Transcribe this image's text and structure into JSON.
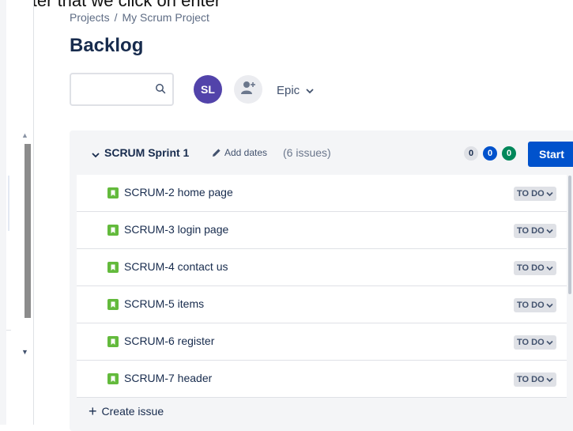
{
  "caption": "After that we click on enter",
  "breadcrumb": {
    "project_root": "Projects",
    "separator": "/",
    "project": "My Scrum Project"
  },
  "page": {
    "title": "Backlog"
  },
  "toolbar": {
    "search_value": "",
    "avatar_initials": "SL",
    "avatar_color": "#5243aa",
    "epic_label": "Epic"
  },
  "sprint": {
    "name": "SCRUM Sprint 1",
    "add_dates": "Add dates",
    "issue_count": "(6 issues)",
    "counts": {
      "todo": "0",
      "in_progress": "0",
      "done": "0"
    },
    "start_label": "Start"
  },
  "issues": [
    {
      "key": "SCRUM-2",
      "summary": "home page",
      "status": "TO DO"
    },
    {
      "key": "SCRUM-3",
      "summary": "login page",
      "status": "TO DO"
    },
    {
      "key": "SCRUM-4",
      "summary": "contact us",
      "status": "TO DO"
    },
    {
      "key": "SCRUM-5",
      "summary": "items",
      "status": "TO DO"
    },
    {
      "key": "SCRUM-6",
      "summary": "register",
      "status": "TO DO"
    },
    {
      "key": "SCRUM-7",
      "summary": "header",
      "status": "TO DO"
    }
  ],
  "create_issue_label": "Create issue",
  "colors": {
    "primary": "#0052cc",
    "story": "#63ba3c",
    "done": "#00875a"
  }
}
